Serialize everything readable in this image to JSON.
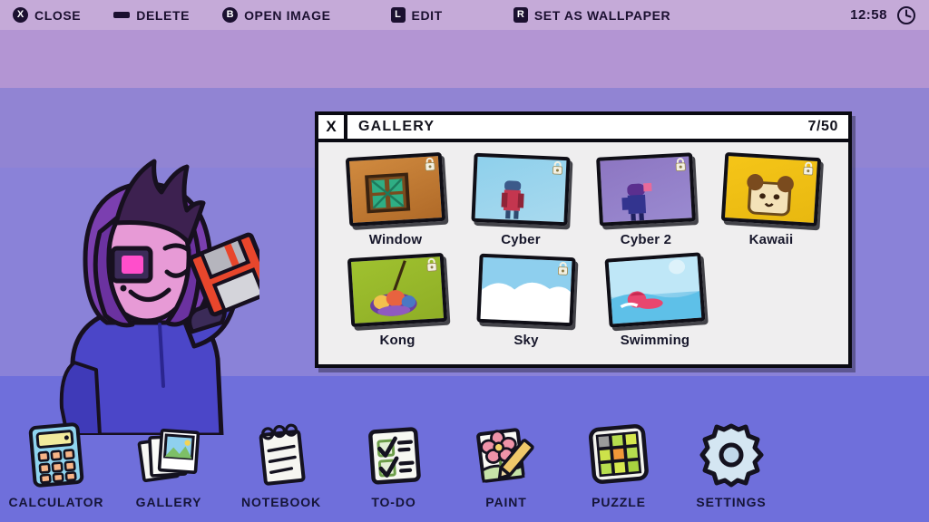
{
  "topbar": {
    "actions": [
      {
        "badge": "X",
        "badge_type": "circle",
        "label": "CLOSE",
        "icon": "x-button-icon"
      },
      {
        "badge": "",
        "badge_type": "minus",
        "label": "DELETE",
        "icon": "minus-button-icon"
      },
      {
        "badge": "B",
        "badge_type": "circle",
        "label": "OPEN IMAGE",
        "icon": "b-button-icon"
      },
      {
        "badge": "L",
        "badge_type": "square",
        "label": "EDIT",
        "icon": "l-button-icon"
      },
      {
        "badge": "R",
        "badge_type": "square",
        "label": "SET AS WALLPAPER",
        "icon": "r-button-icon"
      }
    ],
    "clock": {
      "time": "12:58",
      "icon": "clock-icon"
    },
    "background_color": "#c5aad8",
    "text_color": "#1b1030"
  },
  "desktop": {
    "bands": [
      "#c5aad8",
      "#b395d3",
      "#9184d3",
      "#8a82d8",
      "#6f6fdb"
    ],
    "mascot": {
      "name": "hooded-character-with-floppy-disk",
      "hood_color": "#7b3fb0",
      "face_color": "#e79ad6",
      "hair_color": "#3d2150",
      "hoodie_color": "#4b46c8",
      "eye_patch_color": "#ff4ecb",
      "floppy_color": "#e8462c"
    }
  },
  "gallery_window": {
    "close_label": "X",
    "title": "GALLERY",
    "counter": "7/50",
    "background_color": "#efeeef",
    "border_color": "#0a0a12",
    "rows": [
      [
        {
          "label": "Window",
          "locked": true,
          "bg_top": "#d08a3f",
          "bg_bottom": "#b06a28",
          "art": "window-art",
          "rotate": -3.5
        },
        {
          "label": "Cyber",
          "locked": true,
          "bg_top": "#8ed0ec",
          "bg_bottom": "#a8d9ee",
          "art": "cyber-art",
          "rotate": 2.5
        },
        {
          "label": "Cyber 2",
          "locked": true,
          "bg_top": "#8d76c2",
          "bg_bottom": "#9a8ad0",
          "art": "cyber2-art",
          "rotate": -3.0
        },
        {
          "label": "Kawaii",
          "locked": true,
          "bg_top": "#f5c518",
          "bg_bottom": "#e8b810",
          "art": "kawaii-art",
          "rotate": 3.5
        }
      ],
      [
        {
          "label": "Kong",
          "locked": true,
          "bg_top": "#9fc12f",
          "bg_bottom": "#8fae26",
          "art": "kong-art",
          "rotate": -3.5
        },
        {
          "label": "Sky",
          "locked": true,
          "bg_top": "#8ecfee",
          "bg_bottom": "#ffffff",
          "art": "sky-art",
          "rotate": 2.5
        },
        {
          "label": "Swimming",
          "locked": false,
          "bg_top": "#b8e4f5",
          "bg_bottom": "#6fc2e8",
          "art": "swim-art",
          "rotate": -4.0
        }
      ]
    ]
  },
  "dock": {
    "items": [
      {
        "label": "CALCULATOR",
        "icon": "calculator-icon"
      },
      {
        "label": "GALLERY",
        "icon": "photos-icon"
      },
      {
        "label": "NOTEBOOK",
        "icon": "notebook-icon"
      },
      {
        "label": "TO-DO",
        "icon": "checklist-icon"
      },
      {
        "label": "PAINT",
        "icon": "paint-icon"
      },
      {
        "label": "PUZZLE",
        "icon": "puzzle-grid-icon"
      },
      {
        "label": "SETTINGS",
        "icon": "gear-icon"
      }
    ]
  }
}
